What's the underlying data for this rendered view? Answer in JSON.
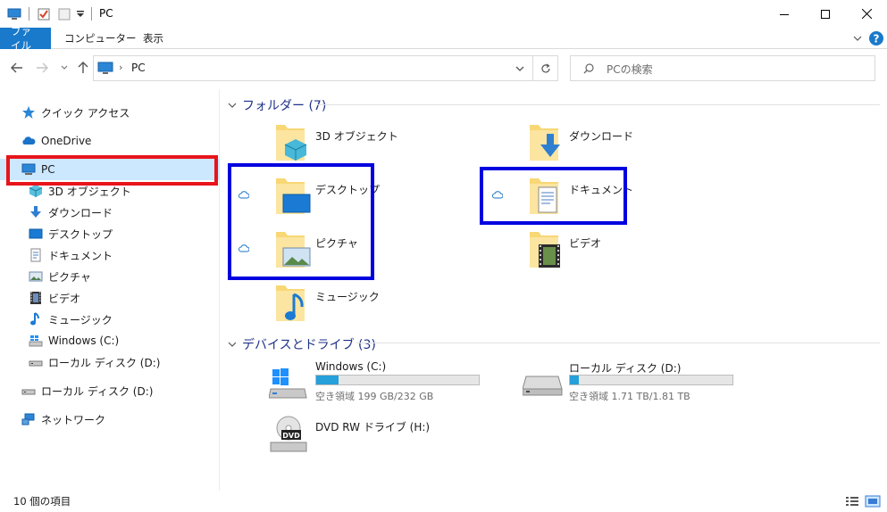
{
  "titlebar": {
    "title": "PC",
    "minimize_label": "—",
    "maximize_label": "☐",
    "close_label": "✕"
  },
  "ribbon": {
    "tabs": [
      "ファイル",
      "コンピューター",
      "表示"
    ]
  },
  "nav": {
    "address_path": "PC",
    "search_placeholder": "PCの検索"
  },
  "sidebar": {
    "items": [
      {
        "label": "クイック アクセス",
        "icon": "star-icon"
      },
      {
        "label": "OneDrive",
        "icon": "cloud-icon"
      },
      {
        "label": "PC",
        "icon": "pc-icon"
      },
      {
        "label": "3D オブジェクト",
        "icon": "3d-objects-icon"
      },
      {
        "label": "ダウンロード",
        "icon": "download-icon"
      },
      {
        "label": "デスクトップ",
        "icon": "desktop-icon"
      },
      {
        "label": "ドキュメント",
        "icon": "document-icon"
      },
      {
        "label": "ピクチャ",
        "icon": "picture-icon"
      },
      {
        "label": "ビデオ",
        "icon": "video-icon"
      },
      {
        "label": "ミュージック",
        "icon": "music-icon"
      },
      {
        "label": "Windows (C:)",
        "icon": "windows-drive-icon"
      },
      {
        "label": "ローカル ディスク (D:)",
        "icon": "disk-icon"
      },
      {
        "label": "ローカル ディスク (D:)",
        "icon": "disk-icon"
      },
      {
        "label": "ネットワーク",
        "icon": "network-icon"
      }
    ]
  },
  "main": {
    "folders_header": "フォルダー (7)",
    "folders": [
      {
        "label": "3D オブジェクト",
        "overlay": "3d-objects-icon",
        "cloud": false
      },
      {
        "label": "ダウンロード",
        "overlay": "download-icon",
        "cloud": false
      },
      {
        "label": "デスクトップ",
        "overlay": "desktop-icon",
        "cloud": true
      },
      {
        "label": "ドキュメント",
        "overlay": "document-icon",
        "cloud": true
      },
      {
        "label": "ピクチャ",
        "overlay": "picture-icon",
        "cloud": true
      },
      {
        "label": "ビデオ",
        "overlay": "video-icon",
        "cloud": false
      },
      {
        "label": "ミュージック",
        "overlay": "music-icon",
        "cloud": false
      }
    ],
    "drives_header": "デバイスとドライブ (3)",
    "drives": [
      {
        "label": "Windows (C:)",
        "free_text": "空き領域 199 GB/232 GB",
        "used_fraction": 0.14
      },
      {
        "label": "ローカル ディスク (D:)",
        "free_text": "空き領域 1.71 TB/1.81 TB",
        "used_fraction": 0.055
      },
      {
        "label": "DVD RW ドライブ (H:)",
        "free_text": "",
        "used_fraction": null
      }
    ]
  },
  "status": {
    "item_count": "10 個の項目"
  },
  "colors": {
    "accent": "#1979ca",
    "group_header": "#1e3287",
    "highlight_red": "#e8141b",
    "highlight_blue": "#0000e0",
    "bar_fill": "#26a0da"
  }
}
